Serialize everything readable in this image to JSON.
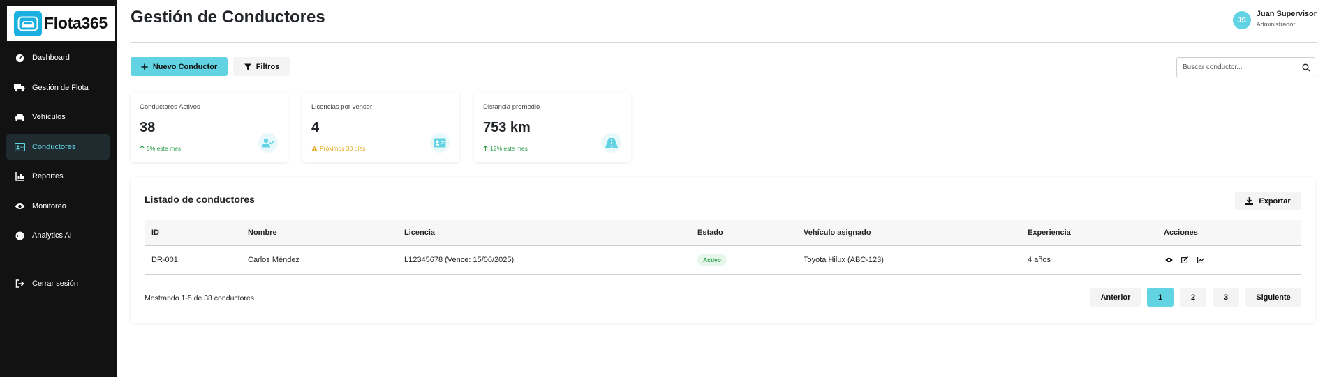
{
  "brand": {
    "name": "Flota365",
    "accent": "#62d3e3",
    "logo_color": "#1ab0e0"
  },
  "sidebar": {
    "items": [
      {
        "label": "Dashboard",
        "icon": "gauge-icon",
        "active": false
      },
      {
        "label": "Gestión de Flota",
        "icon": "truck-icon",
        "active": false
      },
      {
        "label": "Vehículos",
        "icon": "car-icon",
        "active": false
      },
      {
        "label": "Conductores",
        "icon": "id-card-icon",
        "active": true
      },
      {
        "label": "Reportes",
        "icon": "chart-icon",
        "active": false
      },
      {
        "label": "Monitoreo",
        "icon": "eye-icon",
        "active": false
      },
      {
        "label": "Analytics AI",
        "icon": "brain-icon",
        "active": false
      }
    ],
    "logout": "Cerrar sesión"
  },
  "header": {
    "title": "Gestión de Conductores",
    "user": {
      "initials": "JS",
      "name": "Juan Supervisor",
      "role": "Administrador"
    }
  },
  "toolbar": {
    "new_label": "Nuevo Conductor",
    "filter_label": "Filtros",
    "search_placeholder": "Buscar conductor..."
  },
  "stats": [
    {
      "title": "Conductores Activos",
      "value": "38",
      "sub": "5% este mes",
      "tone": "green",
      "icon": "user-check-icon"
    },
    {
      "title": "Licencias por vencer",
      "value": "4",
      "sub": "Próximos 30 días",
      "tone": "orange",
      "icon": "id-card-icon"
    },
    {
      "title": "Distancia promedio",
      "value": "753 km",
      "sub": "12% este mes",
      "tone": "green",
      "icon": "road-icon"
    }
  ],
  "table": {
    "title": "Listado de conductores",
    "export_label": "Exportar",
    "columns": [
      "ID",
      "Nombre",
      "Licencia",
      "Estado",
      "Vehículo asignado",
      "Experiencia",
      "Acciones"
    ],
    "rows": [
      {
        "id": "DR-001",
        "name": "Carlos Méndez",
        "license": "L12345678 (Vence: 15/06/2025)",
        "status": "Activo",
        "vehicle": "Toyota Hilux (ABC-123)",
        "experience": "4 años"
      }
    ],
    "showing": "Mostrando 1-5 de 38 conductores",
    "pagination": {
      "prev": "Anterior",
      "pages": [
        "1",
        "2",
        "3"
      ],
      "current": "1",
      "next": "Siguiente"
    }
  }
}
